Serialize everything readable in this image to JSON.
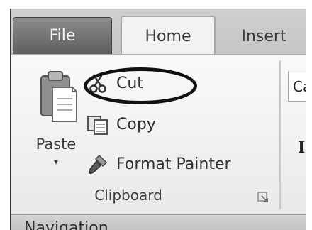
{
  "tabs": {
    "file": "File",
    "home": "Home",
    "insert": "Insert"
  },
  "clipboard": {
    "paste_label": "Paste",
    "paste_dropdown": "▾",
    "cut_label": "Cut",
    "copy_label": "Copy",
    "format_painter_label": "Format Painter",
    "group_label": "Clipboard"
  },
  "font": {
    "font_name_partial": "Ca",
    "bold_glyph": "I"
  },
  "navigation": {
    "title": "Navigation"
  }
}
